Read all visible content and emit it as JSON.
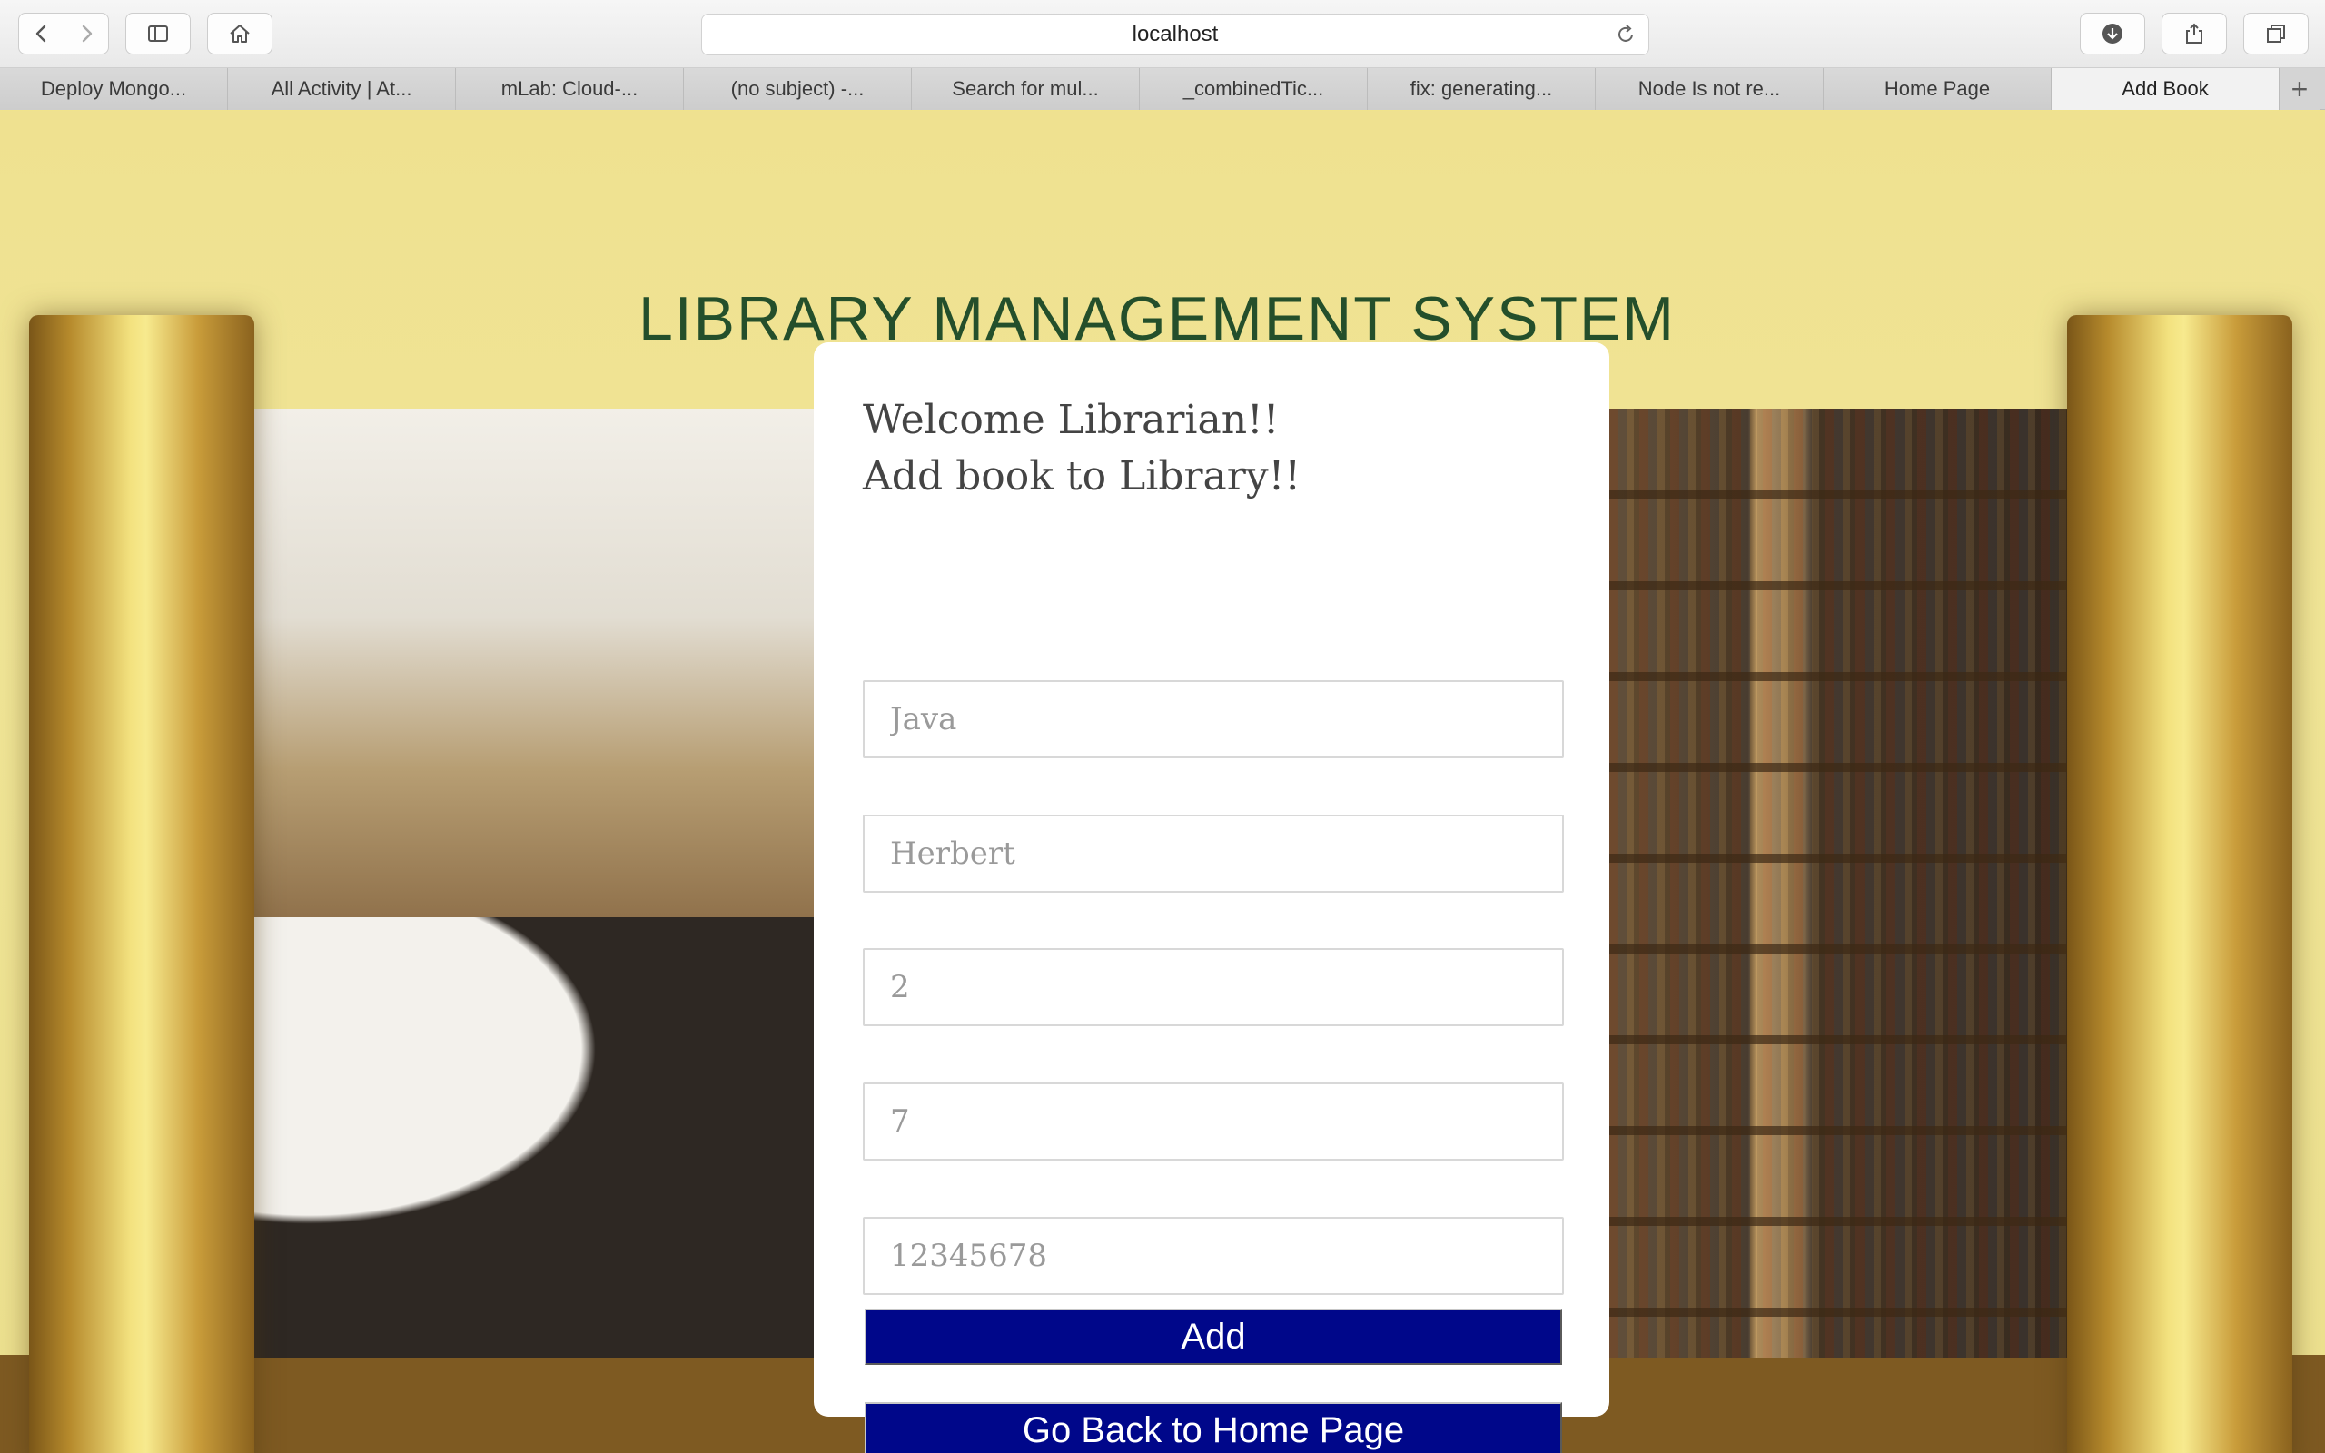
{
  "browser": {
    "address": "localhost",
    "tabs": [
      {
        "label": "Deploy Mongo..."
      },
      {
        "label": "All Activity | At..."
      },
      {
        "label": "mLab: Cloud-..."
      },
      {
        "label": "(no subject) -..."
      },
      {
        "label": "Search for mul..."
      },
      {
        "label": "_combinedTic..."
      },
      {
        "label": "fix: generating..."
      },
      {
        "label": "Node Is not re..."
      },
      {
        "label": "Home Page"
      },
      {
        "label": "Add Book",
        "active": true
      }
    ],
    "new_tab_label": "+"
  },
  "page": {
    "title": "LIBRARY MANAGEMENT SYSTEM",
    "heading_line1": "Welcome Librarian!!",
    "heading_line2": "Add book to Library!!",
    "form": {
      "title_value": "Java",
      "author_value": "Herbert",
      "quantity_value": "2",
      "copies_value": "7",
      "isbn_value": "12345678",
      "add_label": "Add",
      "home_label": "Go Back to Home Page"
    }
  },
  "colors": {
    "button_bg": "#00078a",
    "title_color": "#244f2b",
    "background": "#f0e38c"
  },
  "icons": [
    "back-icon",
    "forward-icon",
    "sidebar-icon",
    "home-icon",
    "reload-icon",
    "download-icon",
    "share-icon",
    "tabs-overview-icon"
  ]
}
